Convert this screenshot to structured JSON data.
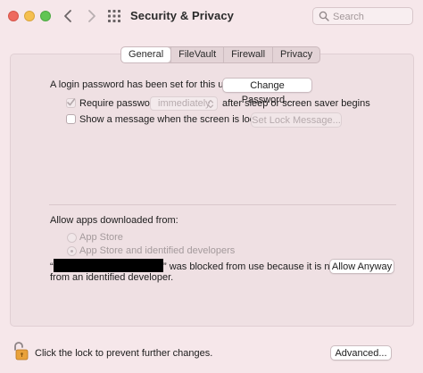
{
  "window": {
    "title": "Security & Privacy",
    "search_placeholder": "Search"
  },
  "tabs": [
    {
      "label": "General",
      "active": true
    },
    {
      "label": "FileVault",
      "active": false
    },
    {
      "label": "Firewall",
      "active": false
    },
    {
      "label": "Privacy",
      "active": false
    }
  ],
  "general": {
    "login_text": "A login password has been set for this user",
    "change_password_label": "Change Password...",
    "require_password_label": "Require password",
    "require_password_checked": true,
    "require_password_enabled": false,
    "require_password_value": "immediately",
    "after_sleep_text": "after sleep or screen saver begins",
    "show_message_label": "Show a message when the screen is locked",
    "show_message_checked": false,
    "set_lock_message_label": "Set Lock Message..."
  },
  "allow_apps": {
    "heading": "Allow apps downloaded from:",
    "options": [
      {
        "label": "App Store",
        "selected": false
      },
      {
        "label": "App Store and identified developers",
        "selected": true
      }
    ],
    "blocked_prefix": "“",
    "blocked_suffix": "” was blocked from use because it is not",
    "blocked_line2": "from an identified developer.",
    "allow_anyway_label": "Allow Anyway"
  },
  "footer": {
    "lock_text": "Click the lock to prevent further changes.",
    "advanced_label": "Advanced..."
  },
  "colors": {
    "background": "#f6e7ea",
    "panel": "#efe0e3",
    "close": "#ee6a5f",
    "minimize": "#f5bf4f",
    "zoom": "#61c554",
    "lock_accent": "#e9a23b"
  },
  "icons": [
    "back-arrow-icon",
    "forward-arrow-icon",
    "grid-icon",
    "search-icon",
    "chevron-updown-icon",
    "checkmark-icon",
    "unlocked-padlock-icon"
  ]
}
